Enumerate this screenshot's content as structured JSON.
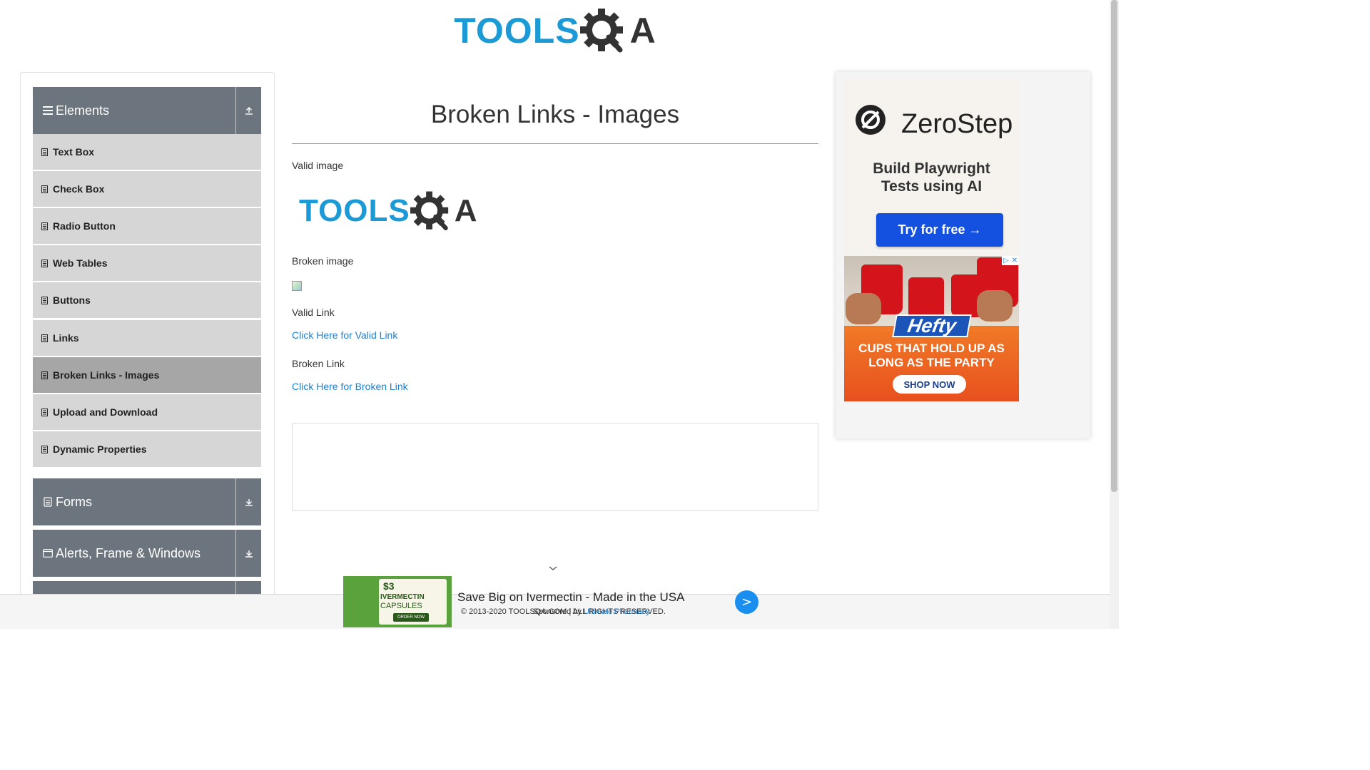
{
  "header": {
    "logo_text": "TOOLS",
    "logo_suffix": "A"
  },
  "sidebar": {
    "groups": [
      {
        "label": "Elements",
        "icon": "hamburger-icon",
        "toggle_icon": "collapse-icon"
      },
      {
        "label": "Forms",
        "icon": "form-icon",
        "toggle_icon": "expand-icon"
      },
      {
        "label": "Alerts, Frame & Windows",
        "icon": "window-icon",
        "toggle_icon": "expand-icon"
      }
    ],
    "items": [
      {
        "label": "Text Box"
      },
      {
        "label": "Check Box"
      },
      {
        "label": "Radio Button"
      },
      {
        "label": "Web Tables"
      },
      {
        "label": "Buttons"
      },
      {
        "label": "Links"
      },
      {
        "label": "Broken Links - Images",
        "active": true
      },
      {
        "label": "Upload and Download"
      },
      {
        "label": "Dynamic Properties"
      }
    ]
  },
  "main": {
    "title": "Broken Links - Images",
    "valid_image_label": "Valid image",
    "broken_image_label": "Broken image",
    "valid_link_label": "Valid Link",
    "valid_link_text": "Click Here for Valid Link",
    "broken_link_label": "Broken Link",
    "broken_link_text": "Click Here for Broken Link"
  },
  "ad_right": {
    "brand": "ZeroStep",
    "subtitle_line1": "Build Playwright",
    "subtitle_line2": "Tests using AI",
    "cta": "Try for free →",
    "hefty_brand": "Hefty",
    "hefty_line1": "CUPS THAT HOLD UP AS",
    "hefty_line2": "LONG AS THE PARTY",
    "hefty_cta": "SHOP NOW"
  },
  "ad_bottom": {
    "thumb_price": "$3",
    "thumb_product": "IVERMECTIN",
    "thumb_form": "CAPSULES",
    "thumb_cta": "ORDER NOW",
    "headline": "Save Big on Ivermectin - Made in the USA",
    "sponsored_by": "Sponsored by ",
    "sponsor": "Ultimate Pharmacy",
    "go": ">"
  },
  "footer": {
    "text": "© 2013-2020 TOOLSQA.COM | ALL RIGHTS RESERVED."
  },
  "colors": {
    "accent": "#1c9ad6",
    "sidebar_header": "#6c757d",
    "link": "#1e7fcf"
  }
}
